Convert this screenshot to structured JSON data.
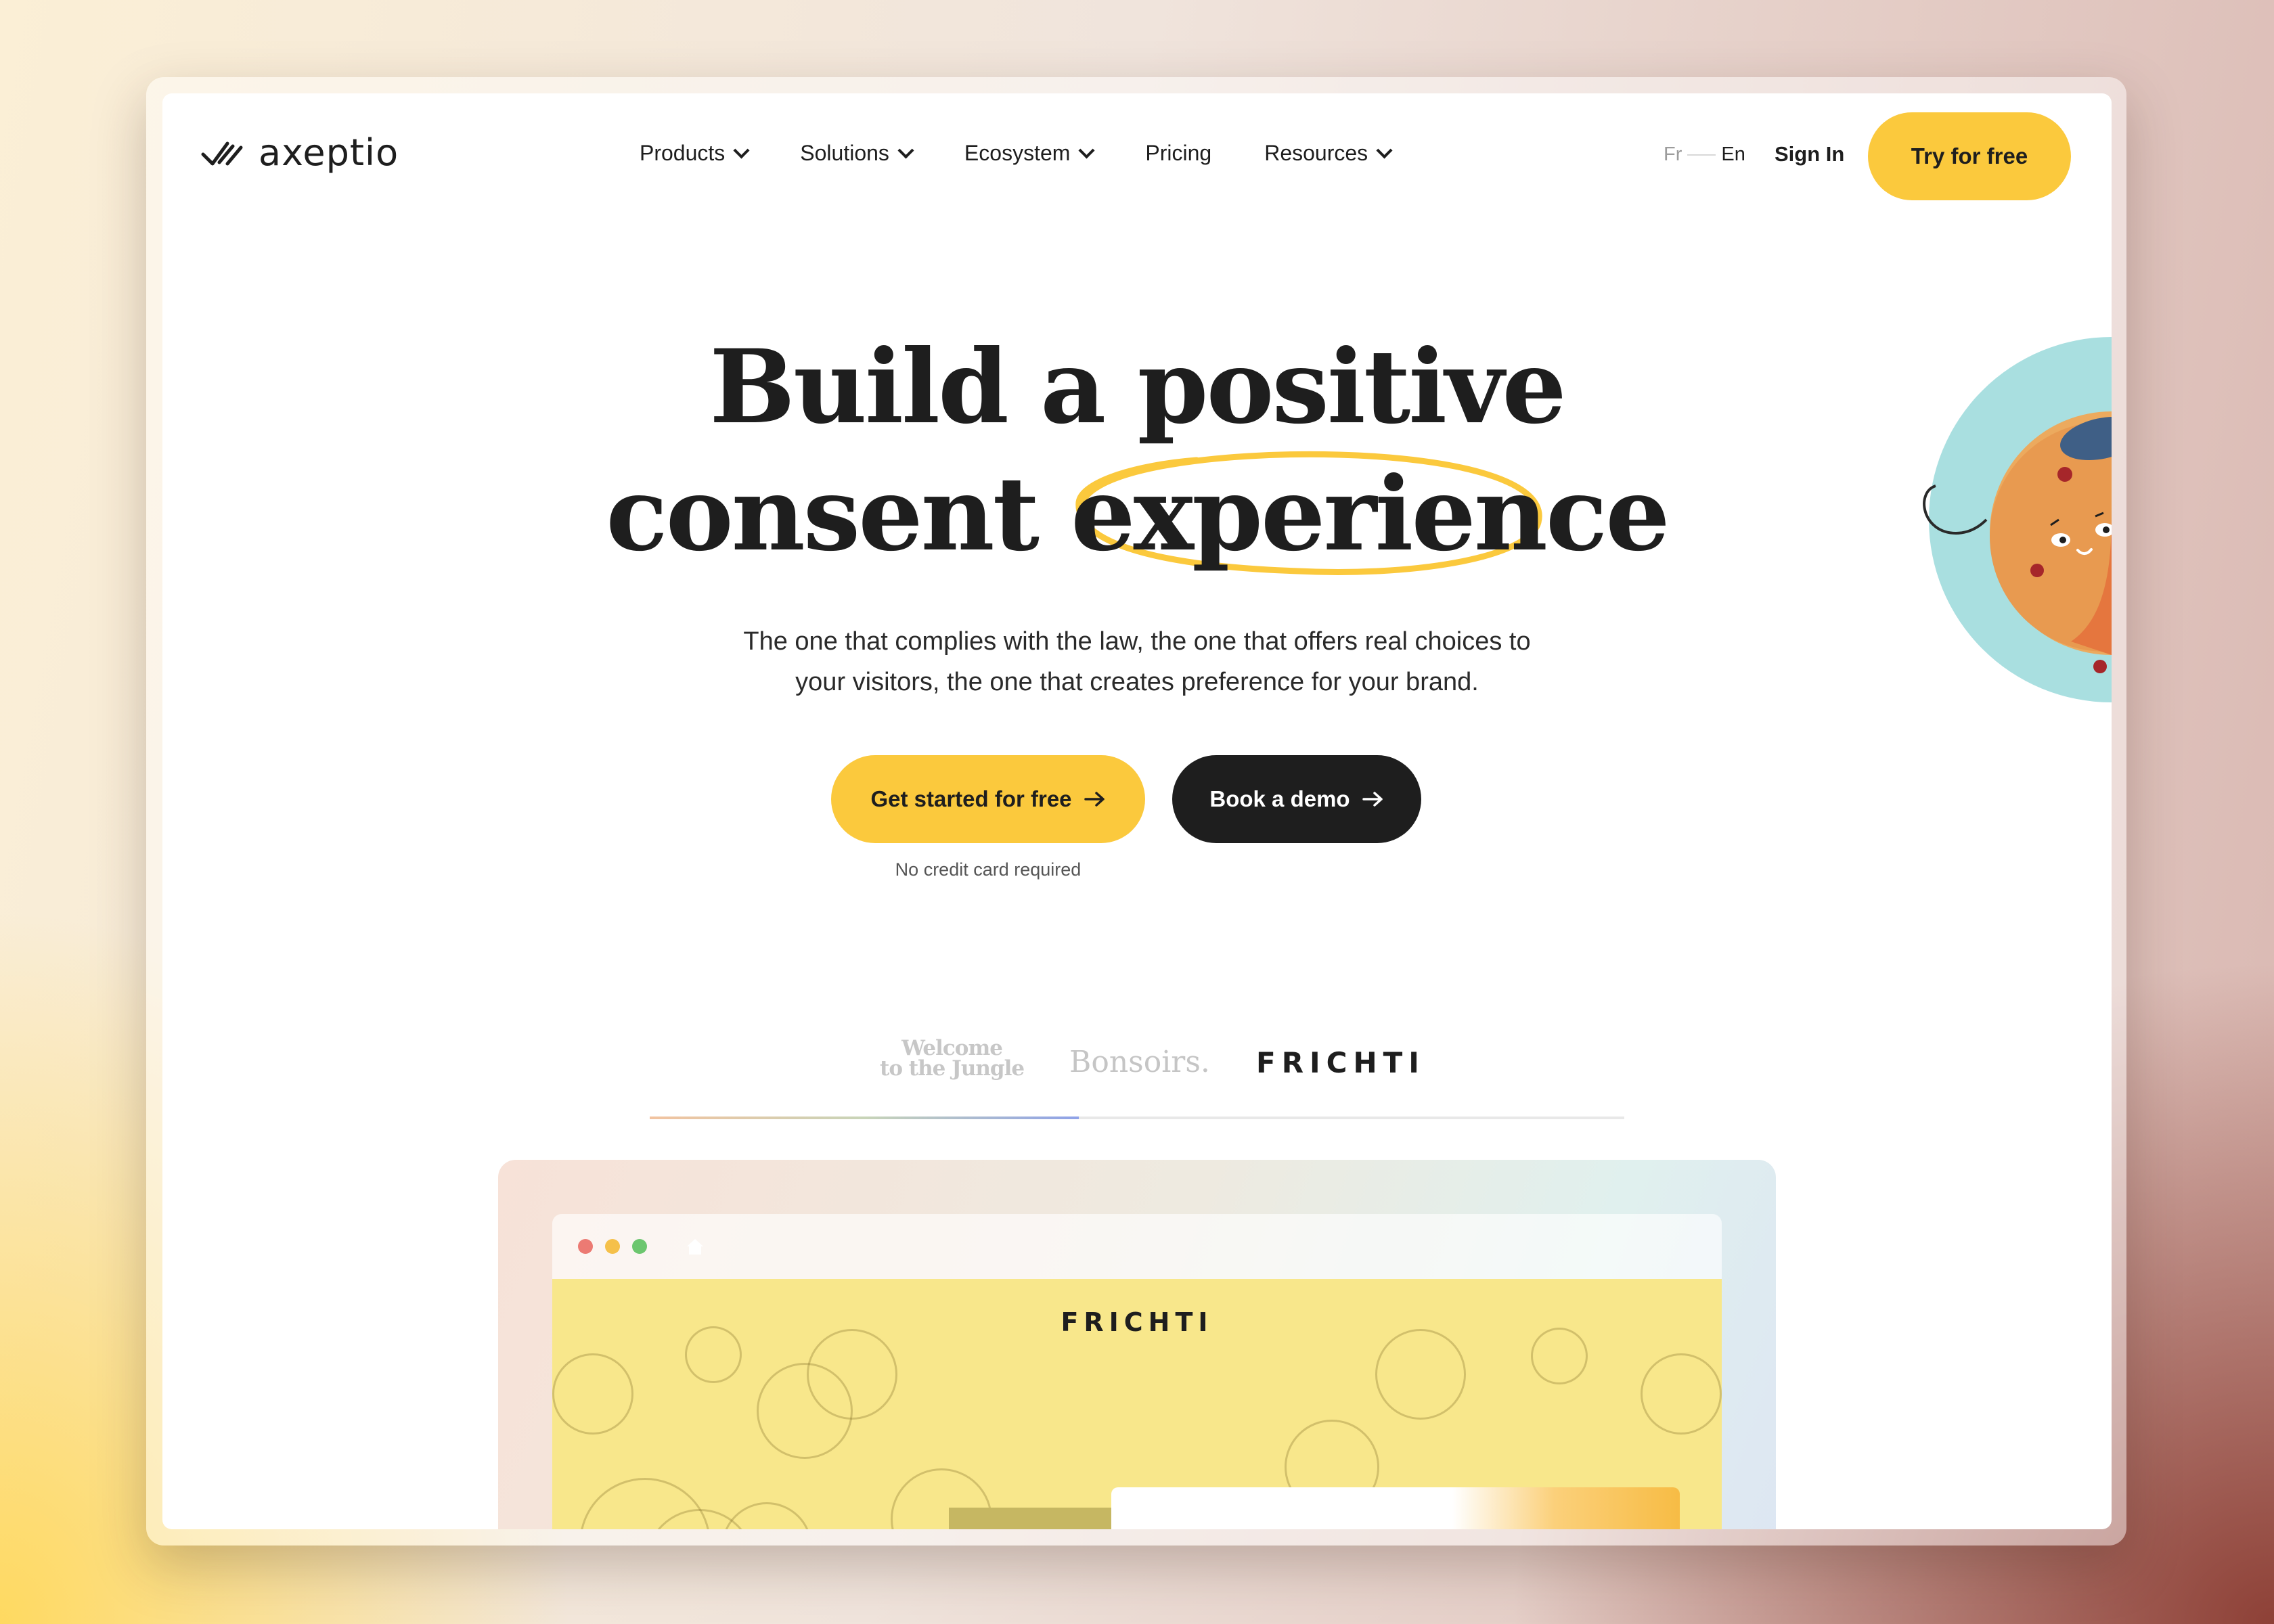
{
  "brand": {
    "name": "axeptio"
  },
  "nav": {
    "items": [
      {
        "label": "Products",
        "dropdown": true
      },
      {
        "label": "Solutions",
        "dropdown": true
      },
      {
        "label": "Ecosystem",
        "dropdown": true
      },
      {
        "label": "Pricing",
        "dropdown": false
      },
      {
        "label": "Resources",
        "dropdown": true
      }
    ]
  },
  "header": {
    "lang_fr": "Fr",
    "lang_en": "En",
    "sign_in": "Sign In",
    "try_free": "Try for free"
  },
  "hero": {
    "title_line1": "Build a positive",
    "title_line2_a": "consent",
    "title_line2_b": "experience",
    "subtitle_line1": "The one that complies with the law, the one that offers real choices to",
    "subtitle_line2": "your visitors, the one that creates preference for your brand.",
    "cta_primary": "Get started for free",
    "cta_secondary": "Book a demo",
    "cta_note": "No credit card required"
  },
  "customers": {
    "logos": [
      {
        "name": "Welcome to the Jungle",
        "line1": "Welcome",
        "line2": "to the Jungle"
      },
      {
        "name": "Bonsoirs.",
        "text": "Bonsoirs."
      },
      {
        "name": "FRICHTI",
        "text": "FRICHTI"
      }
    ],
    "active_index": 2
  },
  "preview": {
    "site_logo": "FRICHTI"
  },
  "colors": {
    "accent_yellow": "#fbc93d",
    "dark": "#1e1e1e",
    "preview_site_bg": "#f8e78b",
    "dot_red": "#ec7a73",
    "dot_yellow": "#f5c04a",
    "dot_green": "#6cc66f"
  },
  "icons": {
    "logo": "axeptio-check-icon",
    "nav_dropdown": "chevron-down-icon",
    "cta_arrow": "arrow-right-icon",
    "browser_home": "home-icon",
    "mascot": "cookie-mascot-icon"
  }
}
